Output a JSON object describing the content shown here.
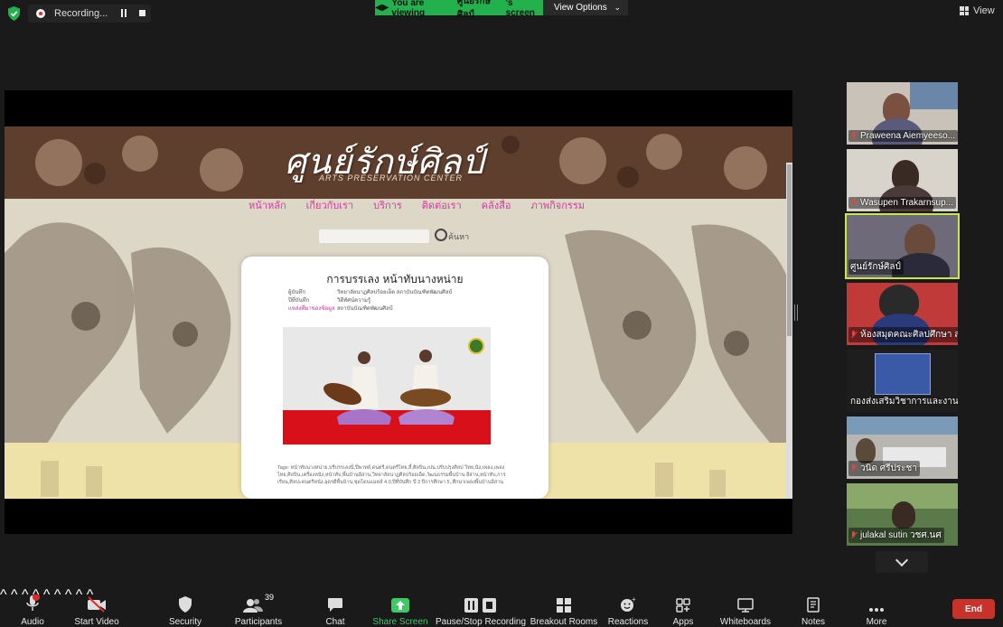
{
  "topbar": {
    "recording_label": "Recording...",
    "viewing_prefix": "You are viewing ",
    "viewing_name": "ศูนย์รักษ์ศิลป์",
    "viewing_suffix": "'s screen",
    "view_options_label": "View Options",
    "view_label": "View"
  },
  "shared_site": {
    "logo_thai": "ศูนย์รักษ์ศิลป์",
    "logo_en": "ARTS PRESERVATION CENTER",
    "nav": [
      "หน้าหลัก",
      "เกี่ยวกับเรา",
      "บริการ",
      "ติดต่อเรา",
      "คลังสื่อ",
      "ภาพกิจกรรม"
    ],
    "search_label": "ค้นหา",
    "card": {
      "title": "การบรรเลง หน้าทับนางหน่าย",
      "meta": [
        {
          "k": "ผู้บันทึก",
          "v": "วิทยาลัยนาฏศิลปร้อยเอ็ด สถาบันบัณฑิตพัฒนศิลป์"
        },
        {
          "k": "ปีที่บันทึก",
          "v": "วิดีทัศน์ความรู้"
        },
        {
          "k": "แหล่งที่มาของข้อมูล",
          "v": "สถาบันบัณฑิตพัฒนศิลป์"
        }
      ],
      "tags": "Tags: หน้าทับนางหน่าย,บรีบรรเลงนี่,ปี่พาทย์,ดนตรี,ดนตรีไทย,ลี้,ศิลปิน,เปน,ปรับปรุงศิลป วิทย,นัง,เพลง,เพลงไทย,ศิลปิน,เครื่องหนัง,หน้าทับ,พื้นบ้านอีสาน,วิทยาลัยนาฏศิลปร้อยเอ็ด,วัฒนธรรมพื้นบ้าน อีสาน,หน้าทับ,การเรียน,ศิลปะดนตรีหนัง,อุดรดีพื้นบ้าน,ชุดโดนแมตส์ 4.0,ปีที่บันทึก ปี 3 ปีการศึกษา 5,,ศึกษาเพลงพื้นบ้านอีสาน"
    }
  },
  "participants": [
    {
      "name": "Praweena Aiemyeeso..."
    },
    {
      "name": "Wasupen Trakarnsup..."
    },
    {
      "name": "ศูนย์รักษ์ศิลป์"
    },
    {
      "name": "ห้องสมุดคณะศิลปศึกษา ส..."
    },
    {
      "name": "กองส่งเสริมวิชาการและงานวิจัย"
    },
    {
      "name": "วนิด ศรีประชา"
    },
    {
      "name": "julakal sutin วชศ.นศ"
    }
  ],
  "toolbar": {
    "audio": "Audio",
    "start_video": "Start Video",
    "security": "Security",
    "participants": "Participants",
    "participants_count": "39",
    "chat": "Chat",
    "share_screen": "Share Screen",
    "pause_stop_recording": "Pause/Stop Recording",
    "breakout_rooms": "Breakout Rooms",
    "reactions": "Reactions",
    "apps": "Apps",
    "whiteboards": "Whiteboards",
    "notes": "Notes",
    "more": "More",
    "end": "End"
  },
  "colors": {
    "accent_green": "#22b14c",
    "end_red": "#c7322b",
    "active_speaker": "#c8e84a"
  }
}
